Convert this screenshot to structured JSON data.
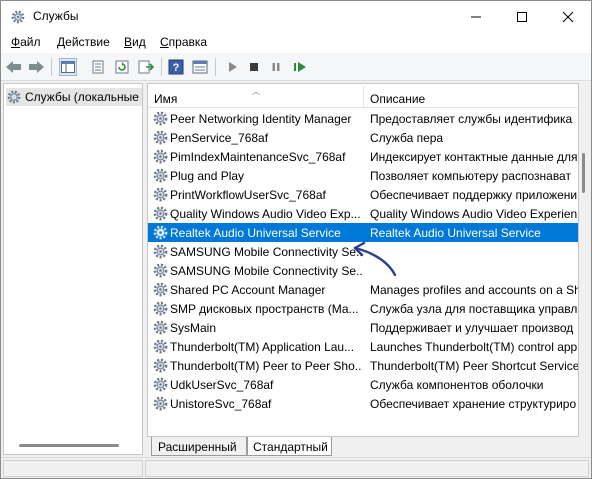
{
  "window": {
    "title": "Службы",
    "icon": "gear-icon"
  },
  "menu": {
    "items": [
      {
        "label": "Файл"
      },
      {
        "label": "Действие"
      },
      {
        "label": "Вид"
      },
      {
        "label": "Справка"
      }
    ]
  },
  "toolbar": {
    "icons": [
      "back-icon",
      "forward-icon",
      "show-tree-icon",
      "export-list-icon",
      "refresh-icon",
      "export-icon",
      "help-icon",
      "properties-icon",
      "start-icon",
      "stop-icon",
      "pause-icon",
      "restart-icon"
    ]
  },
  "tree": {
    "root_label": "Службы (локальные"
  },
  "table": {
    "columns": {
      "name": "Имя",
      "description": "Описание"
    },
    "rows": [
      {
        "name": "Peer Networking Identity Manager",
        "desc": "Предоставляет службы идентифика",
        "selected": false
      },
      {
        "name": "PenService_768af",
        "desc": "Служба пера",
        "selected": false
      },
      {
        "name": "PimIndexMaintenanceSvc_768af",
        "desc": "Индексирует контактные данные для",
        "selected": false
      },
      {
        "name": "Plug and Play",
        "desc": "Позволяет компьютеру распознават",
        "selected": false
      },
      {
        "name": "PrintWorkflowUserSvc_768af",
        "desc": "Обеспечивает поддержку приложени",
        "selected": false
      },
      {
        "name": "Quality Windows Audio Video Exp...",
        "desc": "Quality Windows Audio Video Experien",
        "selected": false
      },
      {
        "name": "Realtek Audio Universal Service",
        "desc": "Realtek Audio Universal Service",
        "selected": true
      },
      {
        "name": "SAMSUNG Mobile Connectivity Se...",
        "desc": "",
        "selected": false
      },
      {
        "name": "SAMSUNG Mobile Connectivity Se...",
        "desc": "",
        "selected": false
      },
      {
        "name": "Shared PC Account Manager",
        "desc": "Manages profiles and accounts on a Sh",
        "selected": false
      },
      {
        "name": "SMP дисковых пространств (Ма...",
        "desc": "Служба узла для поставщика управл",
        "selected": false
      },
      {
        "name": "SysMain",
        "desc": "Поддерживает и улучшает производ",
        "selected": false
      },
      {
        "name": "Thunderbolt(TM) Application Lau...",
        "desc": "Launches Thunderbolt(TM) control app",
        "selected": false
      },
      {
        "name": "Thunderbolt(TM) Peer to Peer Sho...",
        "desc": "Thunderbolt(TM) Peer Shortcut Service",
        "selected": false
      },
      {
        "name": "UdkUserSvc_768af",
        "desc": "Служба компонентов оболочки",
        "selected": false
      },
      {
        "name": "UnistoreSvc_768af",
        "desc": "Обеспечивает хранение структуриро",
        "selected": false
      }
    ]
  },
  "tabs": [
    {
      "label": "Расширенный"
    },
    {
      "label": "Стандартный"
    }
  ],
  "colors": {
    "selection": "#0078d7",
    "annotation_arrow": "#2b3f8a"
  }
}
